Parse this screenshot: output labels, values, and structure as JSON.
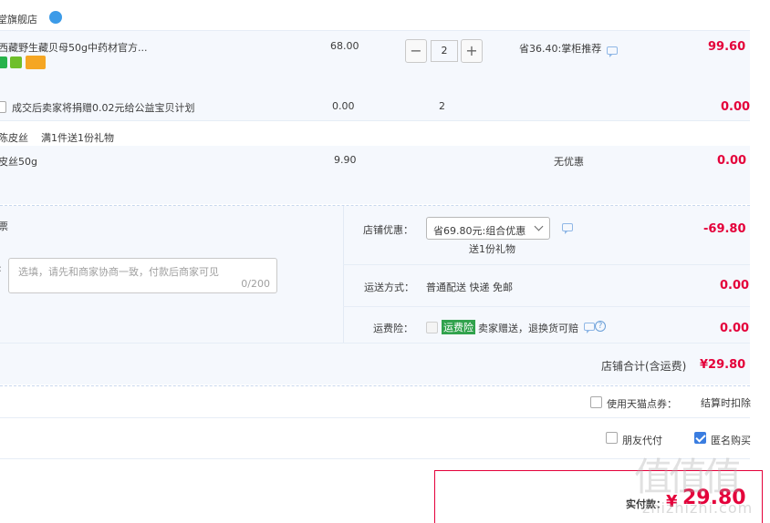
{
  "shop": {
    "name": "药堂旗舰店",
    "badge_icon": "wangwang-icon"
  },
  "item1": {
    "title": "西藏野生藏贝母50g中药材官方...",
    "price": "68.00",
    "qty": "2",
    "promo": "省36.40:掌柜推荐",
    "subtotal": "99.60"
  },
  "item2": {
    "label": "成交后卖家将捐赠0.02元给公益宝贝计划",
    "price": "0.00",
    "qty": "2",
    "subtotal": "0.00"
  },
  "gift_group": {
    "tag": "陈皮丝",
    "desc": "满1件送1份礼物"
  },
  "item3": {
    "title": "皮丝50g",
    "price": "9.90",
    "promo": "无优惠",
    "subtotal": "0.00"
  },
  "left_panel": {
    "label1": "票",
    "label2": ":",
    "memo_placeholder": "选填，请先和商家协商一致，付款后商家可见",
    "memo_count": "0/200"
  },
  "shop_discount": {
    "label": "店铺优惠：",
    "value": "省69.80元:组合优惠",
    "sub": "送1份礼物",
    "amount": "-69.80"
  },
  "shipping": {
    "label": "运送方式：",
    "value": "普通配送 快递 免邮",
    "amount": "0.00"
  },
  "insurance": {
    "label": "运费险：",
    "tag": "运费险",
    "value": "卖家赠送，退换货可赔",
    "amount": "0.00"
  },
  "shop_total": {
    "label": "店铺合计(含运费)",
    "amount": "¥29.80"
  },
  "points": {
    "label": "使用天猫点券：",
    "note": "结算时扣除"
  },
  "options": {
    "friend_pay": "朋友代付",
    "anonymous": "匿名购买"
  },
  "pay": {
    "label": "实付款：",
    "amount": "29.80",
    "currency": "¥"
  },
  "watermark": {
    "main": "值值值",
    "sub": "zhizhizhi.com"
  },
  "colors": {
    "accent": "#e4003a",
    "panel": "#f5f8fd",
    "link": "#3a7de0"
  }
}
